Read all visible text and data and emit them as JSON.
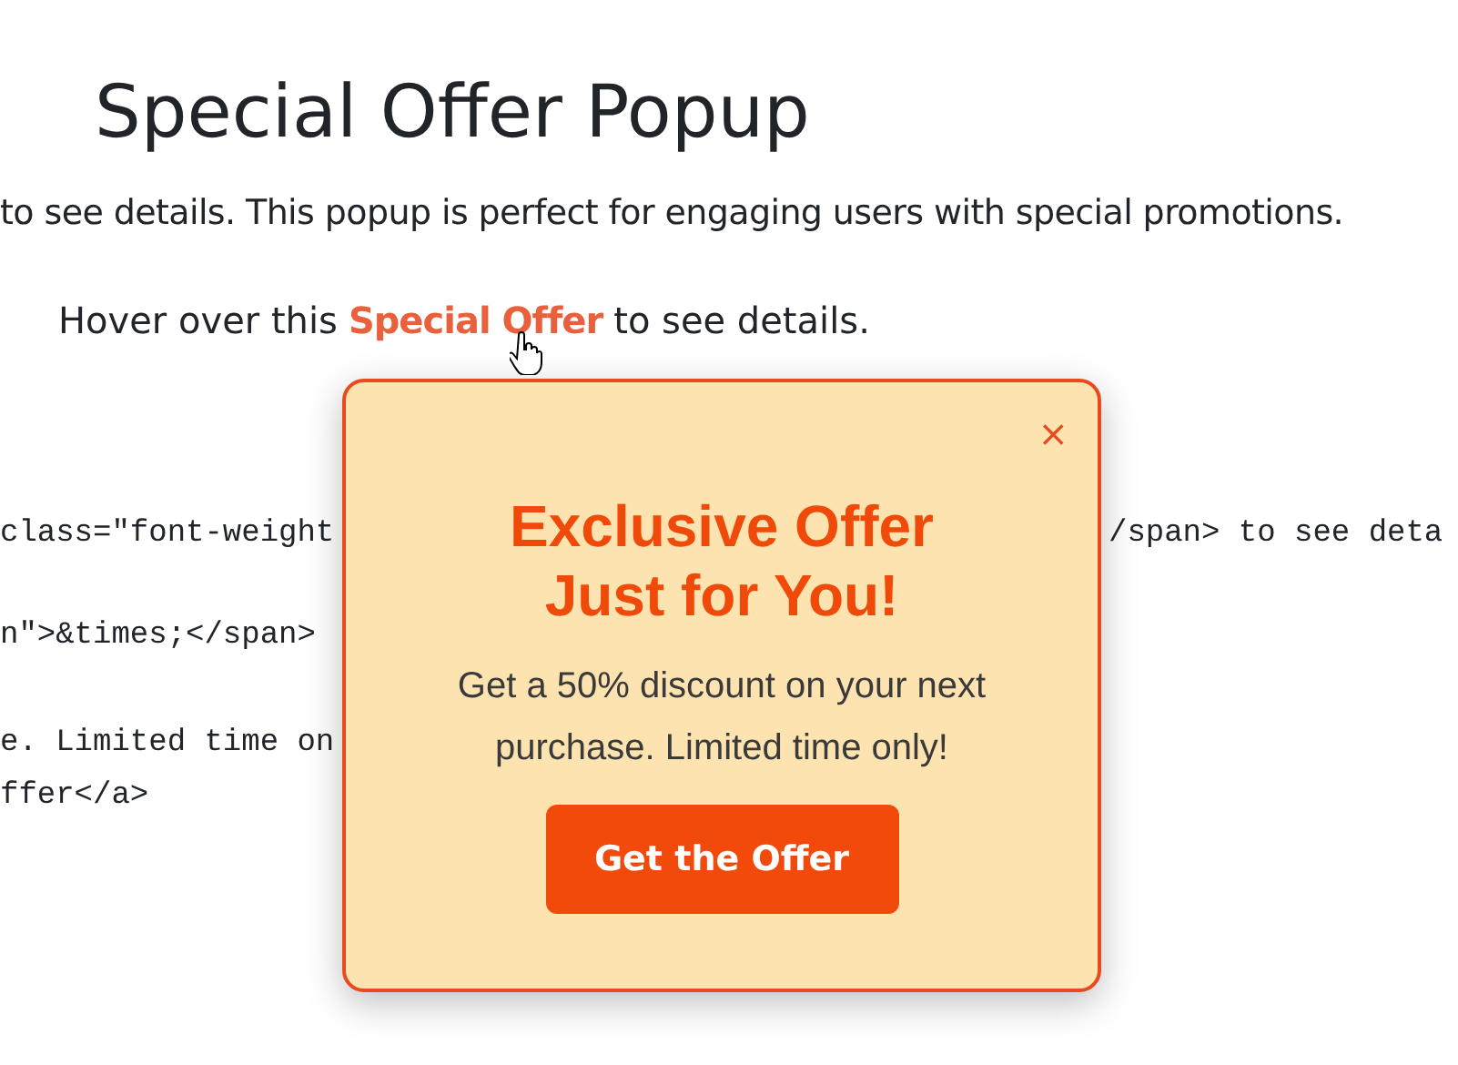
{
  "heading": "Special Offer Popup",
  "intro": "to see details. This popup is perfect for engaging users with special promotions.",
  "hover_line": {
    "before": "Hover over this",
    "link": "Special Offer",
    "after": "to see details."
  },
  "code_lines": [
    {
      "left": "class=\"font-weight",
      "right": "/span> to see deta"
    },
    {
      "left": "n\">&times;</span>"
    },
    {
      "left": "e. Limited time on"
    },
    {
      "left": "ffer</a>"
    }
  ],
  "popup": {
    "close": "×",
    "title": "Exclusive Offer Just for You!",
    "message": "Get a 50% discount on your next purchase. Limited time only!",
    "button": "Get the Offer"
  }
}
